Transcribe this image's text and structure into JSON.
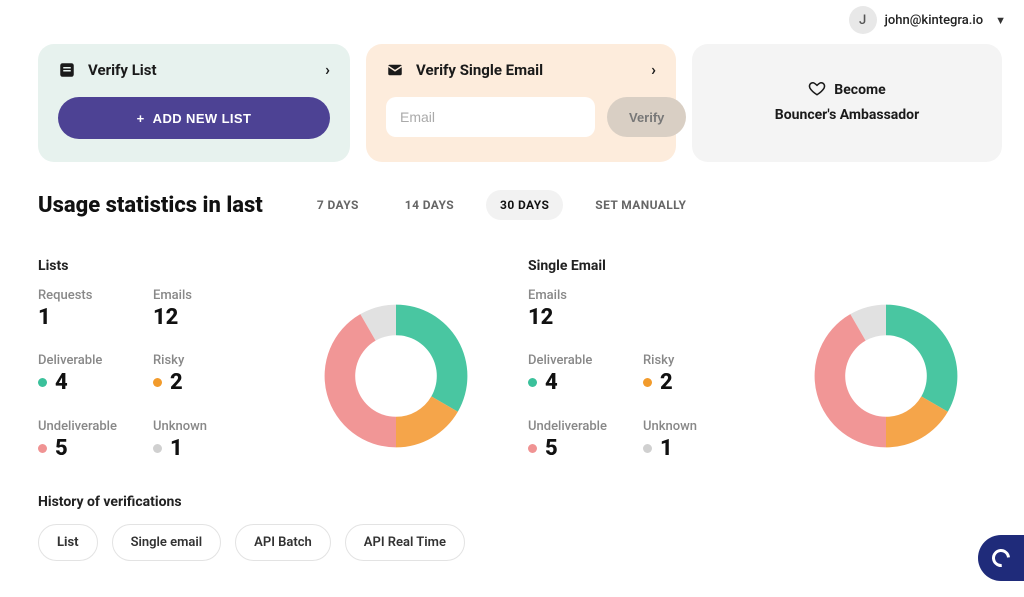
{
  "user": {
    "initial": "J",
    "email": "john@kintegra.io"
  },
  "cards": {
    "verify_list": {
      "title": "Verify List",
      "add_button": "ADD NEW LIST"
    },
    "verify_single": {
      "title": "Verify Single Email",
      "placeholder": "Email",
      "verify_button": "Verify"
    },
    "ambassador": {
      "line1": "Become",
      "line2": "Bouncer's Ambassador"
    }
  },
  "stats": {
    "title": "Usage statistics in last",
    "ranges": [
      "7 DAYS",
      "14 DAYS",
      "30 DAYS",
      "SET MANUALLY"
    ],
    "active_range_index": 2
  },
  "panels": {
    "lists": {
      "title": "Lists",
      "metrics": {
        "requests_label": "Requests",
        "requests": "1",
        "emails_label": "Emails",
        "emails": "12",
        "deliverable_label": "Deliverable",
        "deliverable": "4",
        "risky_label": "Risky",
        "risky": "2",
        "undeliverable_label": "Undeliverable",
        "undeliverable": "5",
        "unknown_label": "Unknown",
        "unknown": "1"
      }
    },
    "single": {
      "title": "Single Email",
      "metrics": {
        "emails_label": "Emails",
        "emails": "12",
        "deliverable_label": "Deliverable",
        "deliverable": "4",
        "risky_label": "Risky",
        "risky": "2",
        "undeliverable_label": "Undeliverable",
        "undeliverable": "5",
        "unknown_label": "Unknown",
        "unknown": "1"
      }
    }
  },
  "history": {
    "title": "History of verifications",
    "tabs": [
      "List",
      "Single email",
      "API Batch",
      "API Real Time"
    ],
    "active_tab_index": 0
  },
  "colors": {
    "deliverable": "#49c6a1",
    "risky": "#f5a54a",
    "undeliverable": "#f19696",
    "unknown": "#e1e1e1"
  },
  "chart_data": [
    {
      "type": "pie",
      "title": "Lists breakdown",
      "categories": [
        "Deliverable",
        "Risky",
        "Undeliverable",
        "Unknown"
      ],
      "values": [
        4,
        2,
        5,
        1
      ]
    },
    {
      "type": "pie",
      "title": "Single Email breakdown",
      "categories": [
        "Deliverable",
        "Risky",
        "Undeliverable",
        "Unknown"
      ],
      "values": [
        4,
        2,
        5,
        1
      ]
    }
  ]
}
